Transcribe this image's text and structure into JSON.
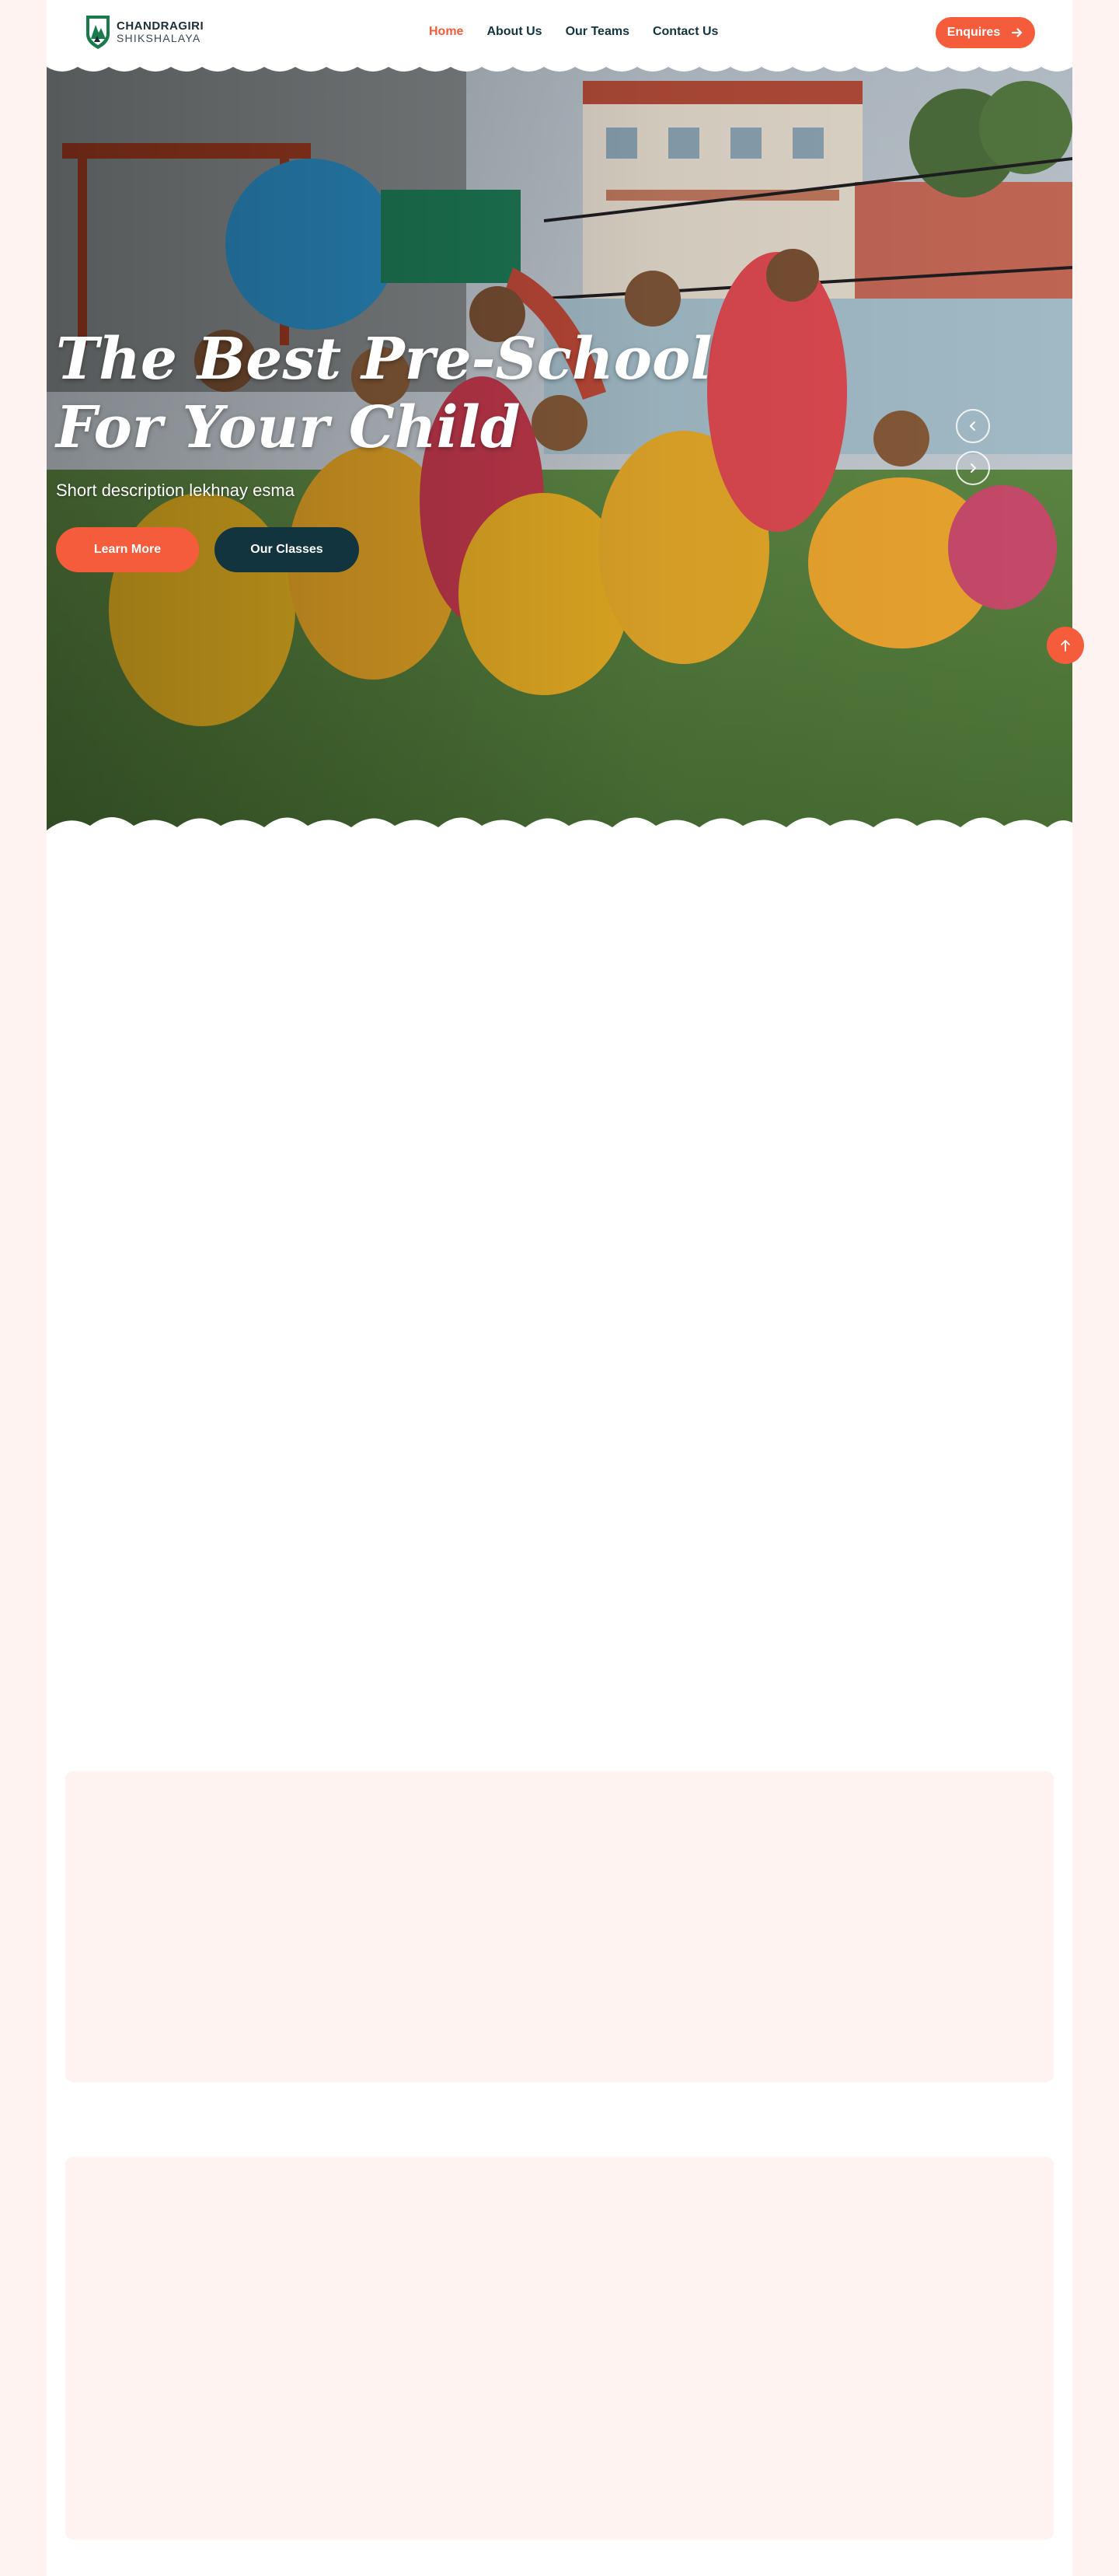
{
  "brand": {
    "name_line1": "CHANDRAGIRI",
    "name_line2": "SHIKSHALAYA",
    "color_primary": "#f45c3b",
    "color_dark": "#12343f",
    "color_logo_green": "#1a7a4c"
  },
  "nav": {
    "items": [
      {
        "label": "Home",
        "active": true
      },
      {
        "label": "About Us",
        "active": false
      },
      {
        "label": "Our Teams",
        "active": false
      },
      {
        "label": "Contact Us",
        "active": false
      }
    ],
    "enquire_label": "Enquires",
    "enquire_icon": "arrow-right-icon"
  },
  "hero": {
    "title": "The Best Pre-School For Your Child",
    "description": "Short description lekhnay esma",
    "learn_more_label": "Learn More",
    "our_classes_label": "Our Classes",
    "prev_icon": "chevron-left-icon",
    "next_icon": "chevron-right-icon"
  },
  "scroll_top_icon": "arrow-up-icon"
}
